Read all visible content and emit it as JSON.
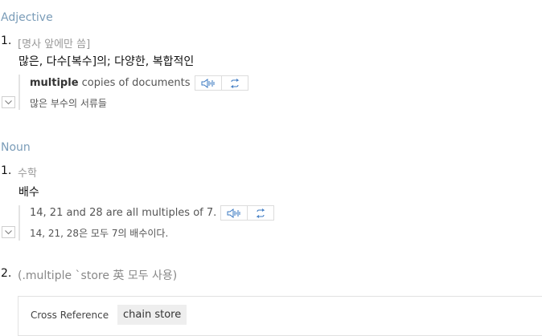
{
  "adjective": {
    "label": "Adjective",
    "sense": {
      "number": "1.",
      "gloss": "[명사 앞에만 씀]",
      "meaning": "많은, 다수[복수]의; 다양한, 복합적인",
      "example": {
        "bold": "multiple",
        "rest": " copies of documents",
        "translation": "많은 부수의 서류들"
      }
    }
  },
  "noun": {
    "label": "Noun",
    "senses": [
      {
        "number": "1.",
        "gloss": "수학",
        "meaning": "배수",
        "example": {
          "text": "14, 21 and 28 are all multiples of 7.",
          "translation": "14, 21, 28은 모두 7의 배수이다."
        }
      },
      {
        "number": "2.",
        "gloss": "(.multiple `store 英 모두 사용)"
      }
    ]
  },
  "cross_reference": {
    "label": "Cross Reference",
    "link": "chain store"
  },
  "icons": {
    "audio": "speaker-icon",
    "repeat": "repeat-icon",
    "expand": "chevron-down-icon"
  },
  "colors": {
    "pos_label": "#7a9cb8",
    "icon_blue": "#3a78c2"
  }
}
